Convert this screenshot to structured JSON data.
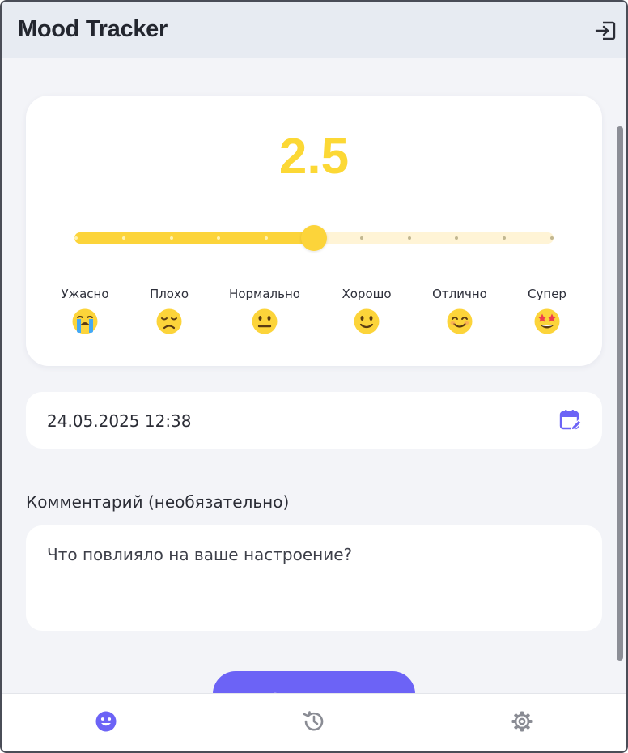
{
  "app": {
    "title": "Mood Tracker"
  },
  "header": {
    "logout_icon": "logout-icon"
  },
  "mood": {
    "score": "2.5",
    "value": 2.5,
    "min": 0,
    "max": 5,
    "accent_color": "#fcd835",
    "levels": [
      {
        "label": "Ужасно",
        "icon": "loudly-crying-face-icon"
      },
      {
        "label": "Плохо",
        "icon": "disappointed-face-icon"
      },
      {
        "label": "Нормально",
        "icon": "neutral-face-icon"
      },
      {
        "label": "Хорошо",
        "icon": "slightly-smiling-face-icon"
      },
      {
        "label": "Отлично",
        "icon": "smiling-face-with-smiling-eyes-icon"
      },
      {
        "label": "Супер",
        "icon": "star-struck-icon"
      }
    ]
  },
  "date": {
    "value": "24.05.2025 12:38",
    "icon": "calendar-edit-icon"
  },
  "comment": {
    "label": "Комментарий (необязательно)",
    "placeholder": "Что повлияло на ваше настроение?",
    "value": ""
  },
  "save_button": {
    "label": "Сохранить",
    "color": "#6c63f6"
  },
  "bottom_nav": [
    {
      "id": "mood",
      "icon": "smiley-face-icon",
      "active": true
    },
    {
      "id": "history",
      "icon": "history-icon",
      "active": false
    },
    {
      "id": "settings",
      "icon": "gear-icon",
      "active": false
    }
  ],
  "colors": {
    "primary": "#6c63f6",
    "background": "#f3f4f8",
    "header": "#e7ebf2"
  }
}
